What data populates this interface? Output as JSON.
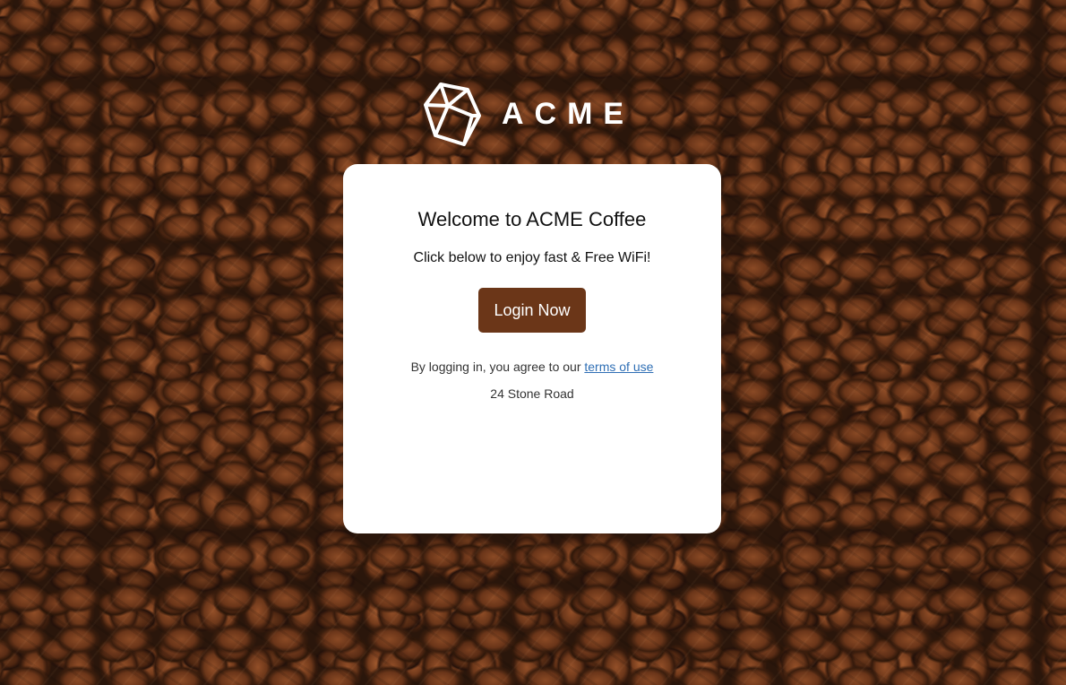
{
  "brand": {
    "name": "ACME",
    "logo_icon": "polyhedron-logo-icon"
  },
  "card": {
    "title": "Welcome to ACME Coffee",
    "subtitle": "Click below to enjoy fast & Free WiFi!",
    "login_label": "Login Now",
    "terms_prefix": "By logging in, you agree to our ",
    "terms_link": "terms of use",
    "address": "24 Stone Road"
  },
  "colors": {
    "button_bg": "#6b3618",
    "link": "#2f6fb5",
    "card_bg": "#ffffff"
  },
  "background": {
    "image": "coffee-beans-background"
  }
}
